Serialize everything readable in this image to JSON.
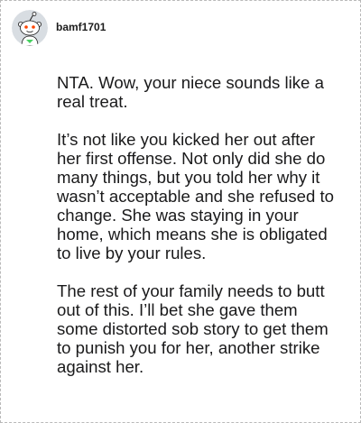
{
  "comment": {
    "author": "bamf1701",
    "avatar_icon": "reddit-snoo-avatar-icon",
    "paragraphs": [
      "NTA. Wow, your niece sounds like a real treat.",
      "It’s not like you kicked her out after her first offense. Not only did she do many things, but you told her why it wasn’t acceptable and she refused to change. She was staying in your home, which means she is obligated to live by your rules.",
      "The rest of your family needs to butt out of this. I’ll bet she gave them some distorted sob story to get them to punish you for her, another strike against her."
    ]
  },
  "colors": {
    "text": "#1a1a1b",
    "border": "#b9b9b9",
    "avatar_bg": "#d8dde2"
  }
}
